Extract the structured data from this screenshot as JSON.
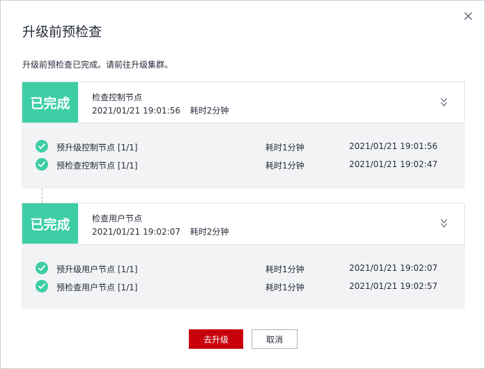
{
  "dialog": {
    "title": "升级前预检查",
    "description": "升级前预检查已完成。请前往升级集群。"
  },
  "groups": [
    {
      "status": "已完成",
      "name": "检查控制节点",
      "time": "2021/01/21 19:01:56",
      "duration": "耗时2分钟",
      "steps": [
        {
          "name": "预升级控制节点 [1/1]",
          "duration": "耗时1分钟",
          "time": "2021/01/21 19:01:56"
        },
        {
          "name": "预检查控制节点 [1/1]",
          "duration": "耗时1分钟",
          "time": "2021/01/21 19:02:47"
        }
      ]
    },
    {
      "status": "已完成",
      "name": "检查用户节点",
      "time": "2021/01/21 19:02:07",
      "duration": "耗时2分钟",
      "steps": [
        {
          "name": "预升级用户节点 [1/1]",
          "duration": "耗时1分钟",
          "time": "2021/01/21 19:02:07"
        },
        {
          "name": "预检查用户节点 [1/1]",
          "duration": "耗时1分钟",
          "time": "2021/01/21 19:02:57"
        }
      ]
    }
  ],
  "buttons": {
    "upgrade": "去升级",
    "cancel": "取消"
  },
  "colors": {
    "success": "#3ecea6",
    "primary": "#c7000b",
    "panel": "#f2f3f5"
  },
  "icons": [
    "close-icon",
    "chevron-double-down-icon",
    "check-circle-icon"
  ]
}
